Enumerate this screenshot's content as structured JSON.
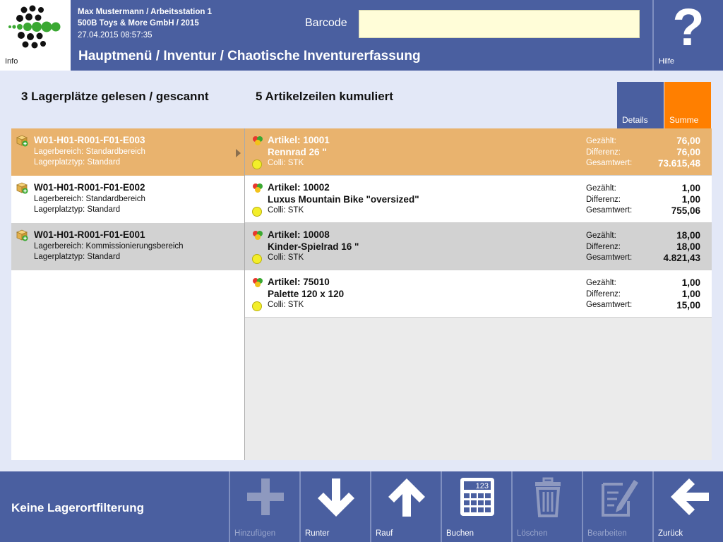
{
  "header": {
    "user": "Max Mustermann / Arbeitsstation 1",
    "company": "500B Toys & More GmbH / 2015",
    "datetime": "27.04.2015 08:57:35",
    "info_label": "Info",
    "barcode_label": "Barcode",
    "barcode_value": "",
    "breadcrumb": "Hauptmenü / Inventur / Chaotische Inventurerfassung",
    "help_label": "Hilfe",
    "help_icon": "question-mark-icon"
  },
  "summary": {
    "locations_read": "3 Lagerplätze gelesen / gescannt",
    "article_lines": "5 Artikelzeilen kumuliert",
    "details_label": "Details",
    "summe_label": "Summe"
  },
  "locations": [
    {
      "code": "W01-H01-R001-F01-E003",
      "area": "Lagerbereich: Standardbereich",
      "type": "Lagerplatztyp: Standard",
      "selected": true
    },
    {
      "code": "W01-H01-R001-F01-E002",
      "area": "Lagerbereich: Standardbereich",
      "type": "Lagerplatztyp: Standard",
      "selected": false
    },
    {
      "code": "W01-H01-R001-F01-E001",
      "area": "Lagerbereich: Kommissionierungsbereich",
      "type": "Lagerplatztyp: Standard",
      "selected": false
    }
  ],
  "article_labels": {
    "counted": "Gezählt:",
    "difference": "Differenz:",
    "total": "Gesamtwert:"
  },
  "articles": [
    {
      "number": "Artikel: 10001",
      "name": "Rennrad 26 \"",
      "colli": "Colli: STK",
      "counted": "76,00",
      "difference": "76,00",
      "total": "73.615,48"
    },
    {
      "number": "Artikel: 10002",
      "name": "Luxus Mountain Bike \"oversized\"",
      "colli": "Colli: STK",
      "counted": "1,00",
      "difference": "1,00",
      "total": "755,06"
    },
    {
      "number": "Artikel: 10008",
      "name": "Kinder-Spielrad 16 \"",
      "colli": "Colli: STK",
      "counted": "18,00",
      "difference": "18,00",
      "total": "4.821,43"
    },
    {
      "number": "Artikel: 75010",
      "name": "Palette 120 x 120",
      "colli": "Colli: STK",
      "counted": "1,00",
      "difference": "1,00",
      "total": "15,00"
    }
  ],
  "toolbar": {
    "filter_label": "Keine Lagerortfilterung",
    "buttons": [
      {
        "label": "Hinzufügen",
        "icon": "plus-icon",
        "enabled": false
      },
      {
        "label": "Runter",
        "icon": "arrow-down-icon",
        "enabled": true
      },
      {
        "label": "Rauf",
        "icon": "arrow-up-icon",
        "enabled": true
      },
      {
        "label": "Buchen",
        "icon": "calculator-icon",
        "enabled": true,
        "icon_text": "123"
      },
      {
        "label": "Löschen",
        "icon": "trash-icon",
        "enabled": false
      },
      {
        "label": "Bearbeiten",
        "icon": "edit-document-icon",
        "enabled": false
      },
      {
        "label": "Zurück",
        "icon": "arrow-left-icon",
        "enabled": true
      }
    ]
  },
  "colors": {
    "header": "#4a5fa0",
    "selected_row": "#e9b36e",
    "summe": "#ff7f00",
    "barcode_bg": "#fffdd8"
  }
}
